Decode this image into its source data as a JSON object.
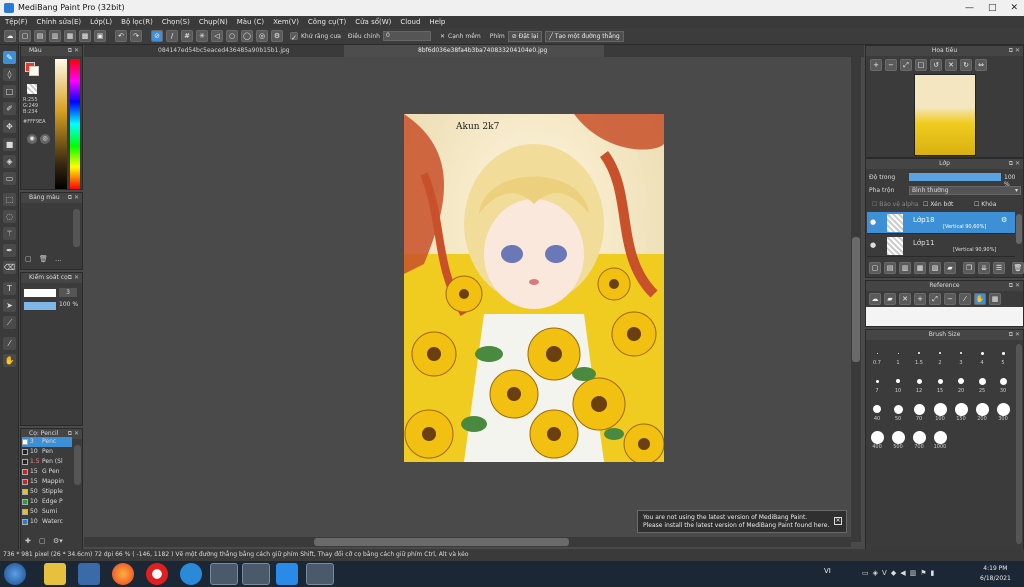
{
  "window": {
    "title": "MediBang Paint Pro (32bit)",
    "btn_min": "—",
    "btn_max": "□",
    "btn_close": "✕"
  },
  "menu": [
    "Tệp(F)",
    "Chỉnh sửa(E)",
    "Lớp(L)",
    "Bộ lọc(R)",
    "Chọn(S)",
    "Chụp(N)",
    "Màu (C)",
    "Xem(V)",
    "Công cụ(T)",
    "Cửa sổ(W)",
    "Cloud",
    "Help"
  ],
  "toolbar": {
    "antialias_label": "Khử răng cưa",
    "adjust_label": "Điều chỉnh",
    "adjust_value": "0",
    "edge_label": "Cạnh mềm",
    "key_label": "Phím",
    "reset_label": "Đặt lại",
    "line_label": "Tạo một đường thẳng"
  },
  "tabs": [
    {
      "label": "084147ed54bc5eaced436485a90b15b1.jpg"
    },
    {
      "label": "8bf6d036e38fa4b3ba740833204104e0.jpg"
    }
  ],
  "color_panel": {
    "title": "Màu",
    "rgb": [
      "R:255",
      "G:249",
      "B:234"
    ],
    "hex": "#FFF9EA"
  },
  "palette_panel": {
    "title": "Bảng màu",
    "more": "..."
  },
  "brush_control": {
    "title": "Kiểm soát cọ",
    "size": "3",
    "opacity": "100 %"
  },
  "brush_list": {
    "title": "Cọ: Pencil",
    "items": [
      {
        "size": "3",
        "name": "Penc",
        "color": "#ffffff",
        "active": true
      },
      {
        "size": "10",
        "name": "Pen",
        "color": "#222222",
        "active": false
      },
      {
        "size": "1.5",
        "name": "Pen (Sl",
        "color": "#222222",
        "active": false
      },
      {
        "size": "15",
        "name": "G Pen",
        "color": "#d42020",
        "active": false
      },
      {
        "size": "15",
        "name": "Mappin",
        "color": "#d42020",
        "active": false
      },
      {
        "size": "50",
        "name": "Stipple",
        "color": "#e8c020",
        "active": false
      },
      {
        "size": "10",
        "name": "Edge P",
        "color": "#20a040",
        "active": false
      },
      {
        "size": "50",
        "name": "Sumi",
        "color": "#e8c020",
        "active": false
      },
      {
        "size": "10",
        "name": "Waterc",
        "color": "#2080d0",
        "active": false
      }
    ]
  },
  "navigator": {
    "title": "Hoa tiêu"
  },
  "layers": {
    "title": "Lớp",
    "opacity_label": "Độ trong",
    "opacity_value": "100 %",
    "blend_label": "Pha trộn",
    "blend_value": "Bình thường",
    "protect_alpha": "Bảo vệ alpha",
    "clipping": "Xén bớt",
    "lock": "Khóa",
    "items": [
      {
        "name": "Lớp18",
        "info": "[Vertical 90,60%]",
        "active": true
      },
      {
        "name": "Lớp11",
        "info": "[Vertical 90,90%]",
        "active": false
      }
    ]
  },
  "reference": {
    "title": "Reference"
  },
  "brush_size": {
    "title": "Brush Size",
    "sizes": [
      "0.7",
      "1",
      "1.5",
      "2",
      "3",
      "4",
      "5",
      "7",
      "10",
      "12",
      "15",
      "20",
      "25",
      "30",
      "40",
      "50",
      "70",
      "100",
      "150",
      "200",
      "300",
      "400",
      "500",
      "700",
      "1000"
    ]
  },
  "artwork": {
    "signature": "Akun 2k7"
  },
  "notification": {
    "line1": "You are not using the latest version of MediBang Paint.",
    "line2": "Please install the latest version of MediBang Paint found here."
  },
  "status": {
    "size": "736 * 981 pixel",
    "cm": "(26 * 34.6cm)",
    "dpi": "72 dpi",
    "zoom": "66 %",
    "coords": "( -146, 1182 )",
    "hint": "Vẽ một đường thẳng bằng cách giữ phím Shift, Thay đổi cỡ cọ bằng cách giữ phím Ctrl, Alt và kéo"
  },
  "taskbar": {
    "lang": "VI",
    "time": "4:19 PM",
    "date": "6/18/2021"
  },
  "colors": {
    "accent": "#3d8fd6",
    "panel": "#3b3b3b",
    "workspace": "#4a4a4a"
  }
}
